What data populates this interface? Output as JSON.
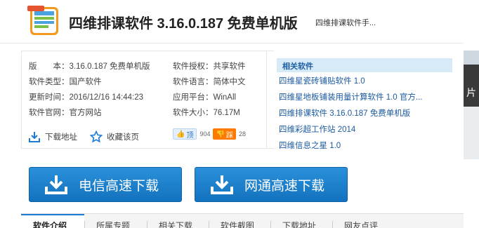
{
  "header": {
    "title": "四维排课软件 3.16.0.187 免费单机版",
    "subtitle": "四维排课软件手..."
  },
  "info": {
    "version": {
      "label": "版　　本：",
      "value": "3.16.0.187 免费单机版"
    },
    "license": {
      "label": "软件授权：",
      "value": "共享软件"
    },
    "type": {
      "label": "软件类型：",
      "value": "国产软件"
    },
    "language": {
      "label": "软件语言：",
      "value": "简体中文"
    },
    "updated": {
      "label": "更新时间：",
      "value": "2016/12/16 14:44:23"
    },
    "platform": {
      "label": "应用平台：",
      "value": "WinAll"
    },
    "website": {
      "label": "软件官网：",
      "value": "官方网站"
    },
    "size": {
      "label": "软件大小：",
      "value": "76.17M"
    },
    "download_link": "下载地址",
    "bookmark": "收藏该页",
    "up_label": "顶",
    "up_count": "904",
    "down_label": "踩",
    "down_count": "28"
  },
  "related": {
    "heading": "相关软件",
    "items": [
      "四维星瓷砖铺贴软件 1.0",
      "四维星地板铺装用量计算软件 1.0 官方...",
      "四维排课软件 3.16.0.187 免费单机版",
      "四维彩超工作站 2014",
      "四维信息之星 1.0"
    ]
  },
  "buttons": {
    "telecom": "电信高速下载",
    "netcom": "网通高速下载"
  },
  "tabs": [
    "软件介绍",
    "所属专题",
    "相关下载",
    "软件截图",
    "下载地址",
    "网友点评"
  ],
  "side_glyph": "片",
  "colors": {
    "accent": "#1c7ad3",
    "button": "#1a80cc",
    "link": "#1c5aa0"
  }
}
